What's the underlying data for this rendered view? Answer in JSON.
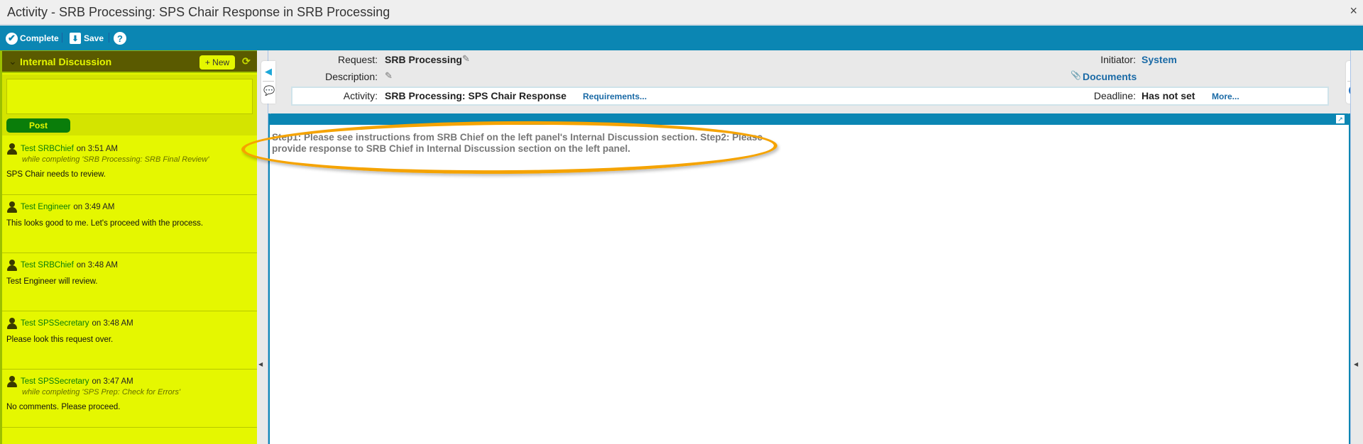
{
  "window": {
    "title": "Activity - SRB Processing: SPS Chair Response in SRB Processing",
    "close_glyph": "×"
  },
  "toolbar": {
    "complete_label": "Complete",
    "save_label": "Save",
    "help_glyph": "?",
    "check_glyph": "✔",
    "save_glyph": "⬇"
  },
  "left_panel": {
    "title": "Internal Discussion",
    "chevron_glyph": "⌄",
    "new_label": "+ New",
    "refresh_glyph": "⟳",
    "compose_value": "",
    "post_label": "Post",
    "comments": [
      {
        "author": "Test SRBChief",
        "time": "on 3:51 AM",
        "context": "while completing 'SRB Processing: SRB Final Review'",
        "body": "SPS Chair needs to review."
      },
      {
        "author": "Test Engineer",
        "time": "on 3:49 AM",
        "context": "",
        "body": "This looks good to me. Let's proceed with the process."
      },
      {
        "author": "Test SRBChief",
        "time": "on 3:48 AM",
        "context": "",
        "body": "Test Engineer will review."
      },
      {
        "author": "Test SPSSecretary",
        "time": "on 3:48 AM",
        "context": "",
        "body": "Please look this request over."
      },
      {
        "author": "Test SPSSecretary",
        "time": "on 3:47 AM",
        "context": "while completing 'SPS Prep: Check for Errors'",
        "body": "No comments. Please proceed."
      }
    ]
  },
  "info": {
    "request_label": "Request:",
    "request_value": "SRB Processing",
    "description_label": "Description:",
    "activity_label": "Activity:",
    "activity_value": "SRB Processing: SPS Chair Response",
    "requirements_link": "Requirements...",
    "initiator_label": "Initiator:",
    "initiator_value": "System",
    "documents_link": "Documents",
    "deadline_label": "Deadline:",
    "deadline_value": "Has not set",
    "more_link": "More...",
    "pencil_glyph": "✎",
    "paperclip_glyph": "📎"
  },
  "side_tabs": {
    "left_arrow": "◀",
    "chat_glyph": "💬",
    "info_glyph": "ℹ"
  },
  "content": {
    "expand_glyph": "↗",
    "instructions": "Step1: Please see instructions from SRB Chief on the left panel's Internal Discussion section. Step2: Please provide response to SRB Chief in Internal Discussion section on the left panel."
  },
  "colors": {
    "toolbar_blue": "#0b86b3",
    "discussion_bg": "#e5f700",
    "discussion_header": "#5a5a00",
    "post_green": "#0a7d0a",
    "highlight_orange": "#f5a300",
    "link_blue": "#1a6aa6"
  }
}
